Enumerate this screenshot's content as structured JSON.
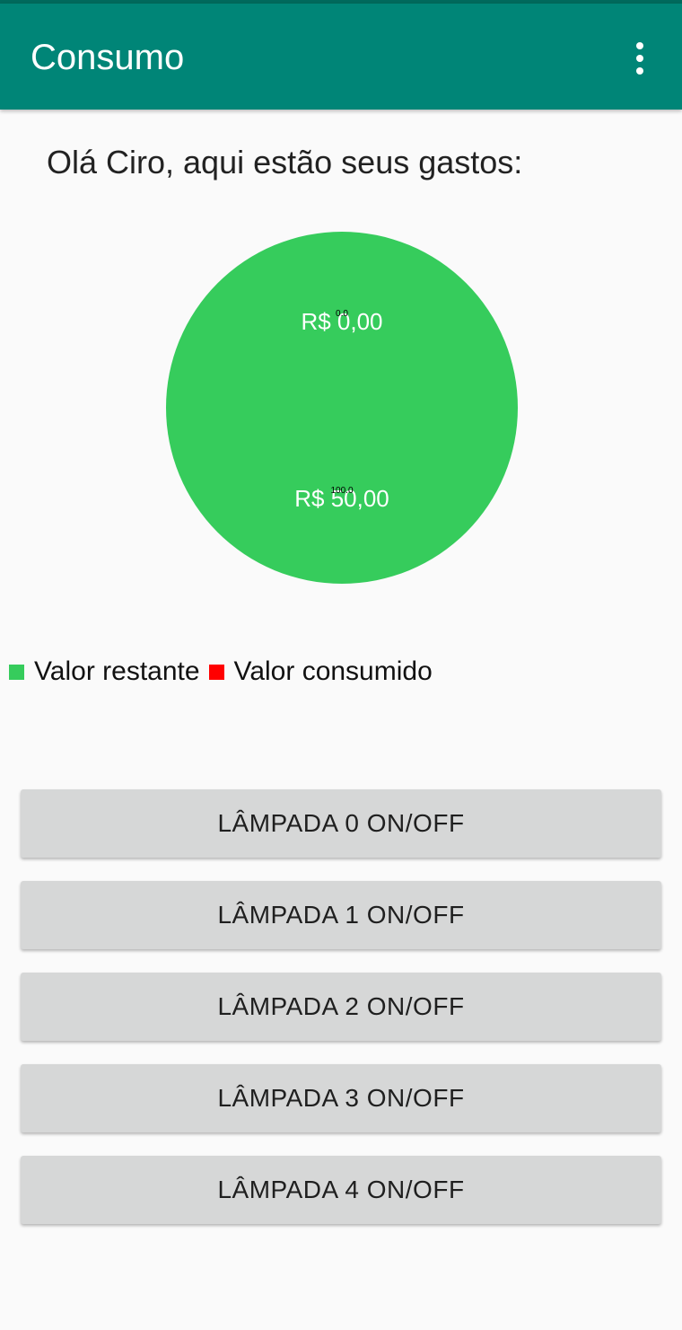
{
  "app_bar": {
    "title": "Consumo",
    "color": "#008577",
    "menu_icon": "more-vert-icon"
  },
  "greeting": "Olá Ciro, aqui estão seus gastos:",
  "chart_data": {
    "type": "pie",
    "slices": [
      {
        "label": "Valor restante",
        "value": 100.0,
        "percent_label": "100.0",
        "value_label": "R$ 50,00",
        "color": "#36cc5c"
      },
      {
        "label": "Valor consumido",
        "value": 0.0,
        "percent_label": "0.0",
        "value_label": "R$ 0,00",
        "color": "#ff0000"
      }
    ],
    "legend_position": "bottom-left"
  },
  "legend": [
    {
      "label": "Valor restante",
      "color": "#36cc5c"
    },
    {
      "label": "Valor consumido",
      "color": "#ff0000"
    }
  ],
  "buttons": [
    {
      "label": "LÂMPADA 0 ON/OFF"
    },
    {
      "label": "LÂMPADA 1 ON/OFF"
    },
    {
      "label": "LÂMPADA 2 ON/OFF"
    },
    {
      "label": "LÂMPADA 3 ON/OFF"
    },
    {
      "label": "LÂMPADA 4 ON/OFF"
    }
  ]
}
